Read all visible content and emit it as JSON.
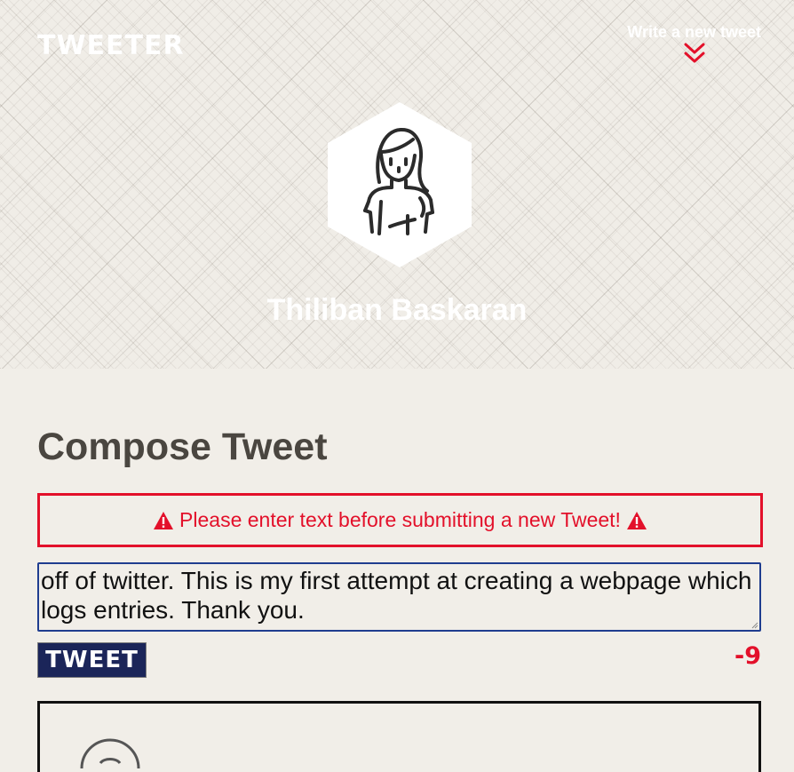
{
  "header": {
    "brand": "TWEETER",
    "new_tweet_label": "Write a new tweet",
    "new_tweet_icon": "double-chevron-down-icon",
    "avatar_icon": "user-avatar-icon",
    "profile_name": "Thiliban Baskaran"
  },
  "compose": {
    "title": "Compose Tweet",
    "error_message": "Please enter text before submitting a new Tweet!",
    "error_icon": "warning-icon",
    "input_value": "off of twitter. This is my first attempt at creating a webpage which logs entries. Thank you.",
    "submit_label": "TWEET",
    "char_counter": "-9"
  },
  "colors": {
    "accent_red": "#e3102a",
    "button_navy": "#1b2559",
    "heading": "#4a4640",
    "background": "#f1eee8"
  }
}
